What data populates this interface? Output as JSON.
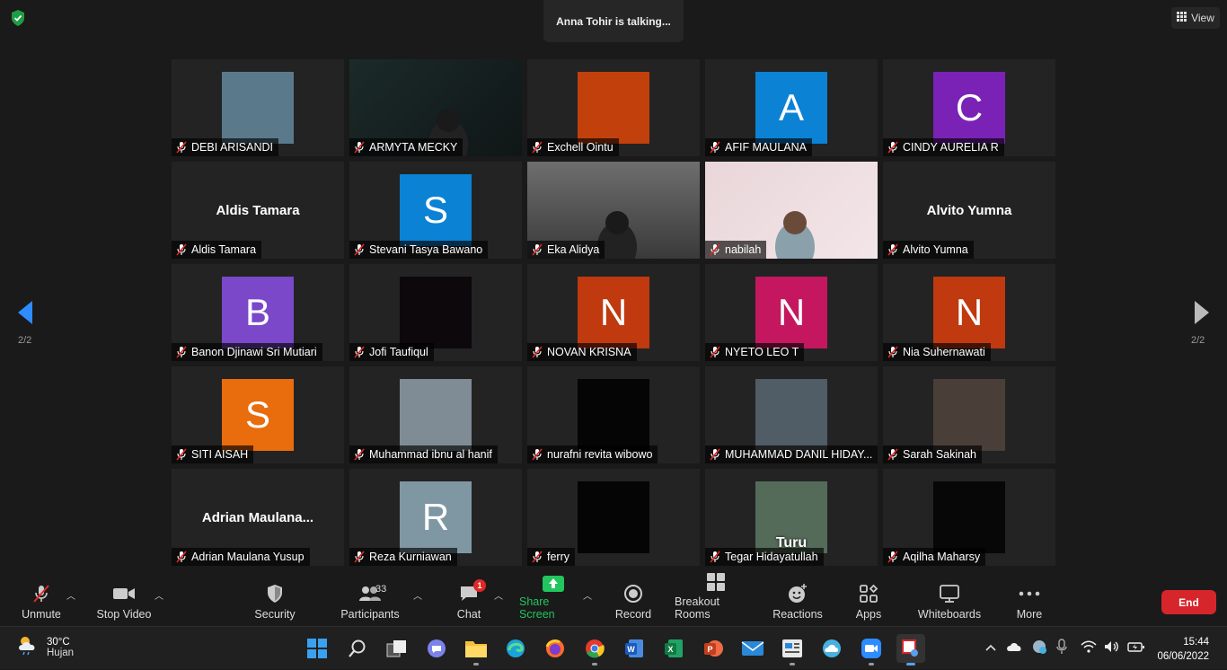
{
  "meeting": {
    "talking_indicator": "Anna Tohir is talking...",
    "view_label": "View",
    "page_left": "2/2",
    "page_right": "2/2"
  },
  "participants": [
    {
      "name": "DEBI ARISANDI",
      "tile": "photo",
      "avatar_color": "#5a7a8c"
    },
    {
      "name": "ARMYTA MECKY",
      "tile": "video"
    },
    {
      "name": "Exchell Ointu",
      "tile": "photo",
      "avatar_color": "#c2400c"
    },
    {
      "name": "AFIF MAULANA",
      "tile": "letter",
      "letter": "A",
      "avatar_color": "#0b82d4"
    },
    {
      "name": "CINDY AURELIA R",
      "tile": "letter",
      "letter": "C",
      "avatar_color": "#7a22b5"
    },
    {
      "name": "Aldis Tamara",
      "tile": "name",
      "big_name": "Aldis Tamara"
    },
    {
      "name": "Stevani Tasya Bawano",
      "tile": "letter",
      "letter": "S",
      "avatar_color": "#0b82d4"
    },
    {
      "name": "Eka Alidya",
      "tile": "video"
    },
    {
      "name": "nabilah",
      "tile": "video"
    },
    {
      "name": "Alvito Yumna",
      "tile": "name",
      "big_name": "Alvito Yumna"
    },
    {
      "name": "Banon Djinawi Sri Mutiari",
      "tile": "letter",
      "letter": "B",
      "avatar_color": "#7a48c8"
    },
    {
      "name": "Jofi Taufiqul",
      "tile": "photo",
      "avatar_color": "#0d080c"
    },
    {
      "name": "NOVAN KRISNA",
      "tile": "letter",
      "letter": "N",
      "avatar_color": "#c0390f"
    },
    {
      "name": "NYETO LEO T",
      "tile": "letter",
      "letter": "N",
      "avatar_color": "#c4175f"
    },
    {
      "name": "Nia Suhernawati",
      "tile": "letter",
      "letter": "N",
      "avatar_color": "#c0390f"
    },
    {
      "name": "SITI AISAH",
      "tile": "letter",
      "letter": "S",
      "avatar_color": "#e96c0d"
    },
    {
      "name": "Muhammad ibnu al hanif",
      "tile": "photo",
      "avatar_color": "#7f8c96"
    },
    {
      "name": "nurafni revita wibowo",
      "tile": "photo",
      "avatar_color": "#050505"
    },
    {
      "name": "MUHAMMAD DANIL HIDAY...",
      "tile": "photo",
      "avatar_color": "#505c66"
    },
    {
      "name": "Sarah Sakinah",
      "tile": "photo",
      "avatar_color": "#4a3e38"
    },
    {
      "name": "Adrian Maulana Yusup",
      "tile": "name",
      "big_name": "Adrian  Maulana..."
    },
    {
      "name": "Reza Kurniawan",
      "tile": "letter",
      "letter": "R",
      "avatar_color": "#7f97a3"
    },
    {
      "name": "ferry",
      "tile": "photo",
      "avatar_color": "#050505"
    },
    {
      "name": "Tegar Hidayatullah",
      "tile": "photo",
      "avatar_color": "#556b5a",
      "caption": "Turu"
    },
    {
      "name": "Aqilha Maharsy",
      "tile": "photo",
      "avatar_color": "#070707"
    }
  ],
  "toolbar": {
    "unmute": "Unmute",
    "stop_video": "Stop Video",
    "security": "Security",
    "participants": "Participants",
    "participants_count": "33",
    "chat": "Chat",
    "chat_badge": "1",
    "share_screen": "Share Screen",
    "record": "Record",
    "breakout_rooms": "Breakout Rooms",
    "reactions": "Reactions",
    "apps": "Apps",
    "whiteboards": "Whiteboards",
    "more": "More",
    "end": "End",
    "share_color": "#22c55e",
    "end_color": "#d6262b"
  },
  "taskbar": {
    "temperature": "30°C",
    "weather": "Hujan",
    "time": "15:44",
    "date": "06/06/2022"
  }
}
